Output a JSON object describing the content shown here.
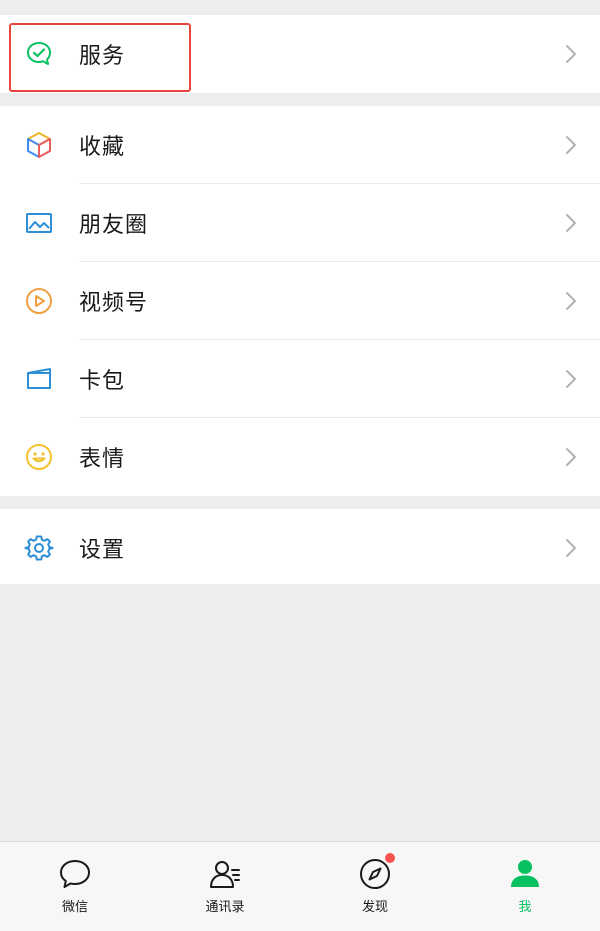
{
  "menu": {
    "service": {
      "label": "服务",
      "icon": "service-icon"
    },
    "items": [
      {
        "label": "收藏",
        "icon": "favorites-cube-icon"
      },
      {
        "label": "朋友圈",
        "icon": "moments-image-icon"
      },
      {
        "label": "视频号",
        "icon": "channels-play-icon"
      },
      {
        "label": "卡包",
        "icon": "card-wallet-icon"
      },
      {
        "label": "表情",
        "icon": "sticker-smile-icon"
      }
    ],
    "settings": {
      "label": "设置",
      "icon": "gear-icon"
    }
  },
  "tabbar": {
    "tabs": [
      {
        "label": "微信",
        "icon": "chat-bubble-icon",
        "active": false
      },
      {
        "label": "通讯录",
        "icon": "contacts-icon",
        "active": false
      },
      {
        "label": "发现",
        "icon": "compass-icon",
        "active": false,
        "badge": true
      },
      {
        "label": "我",
        "icon": "person-icon",
        "active": true
      }
    ]
  },
  "colors": {
    "accent_green": "#07c160",
    "highlight_red": "#e8473f",
    "badge_red": "#fa5151",
    "background": "#ededed"
  }
}
